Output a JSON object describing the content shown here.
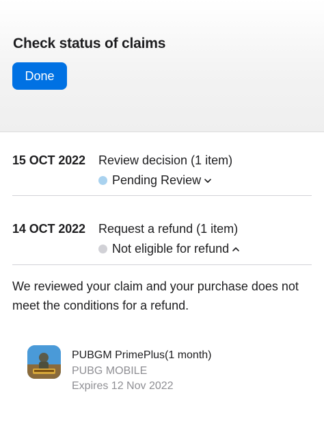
{
  "header": {
    "title": "Check status of claims",
    "done_label": "Done"
  },
  "claims": [
    {
      "date": "15 OCT 2022",
      "action": "Review decision (1 item)",
      "status": "Pending Review",
      "status_color": "#a9d2ef",
      "chevron": "chevron-down-icon"
    },
    {
      "date": "14 OCT 2022",
      "action": "Request a refund (1 item)",
      "status": "Not eligible for refund",
      "status_color": "#d1d1d6",
      "chevron": "chevron-up-icon"
    }
  ],
  "explanation": "We reviewed your claim and your purchase does not meet the conditions for a refund.",
  "product": {
    "name": "PUBGM PrimePlus(1 month)",
    "developer": "PUBG MOBILE",
    "expiry": "Expires 12 Nov 2022",
    "icon": "pubg-mobile-app-icon"
  },
  "colors": {
    "accent": "#0071e3",
    "secondary_text": "#8e8e93"
  }
}
